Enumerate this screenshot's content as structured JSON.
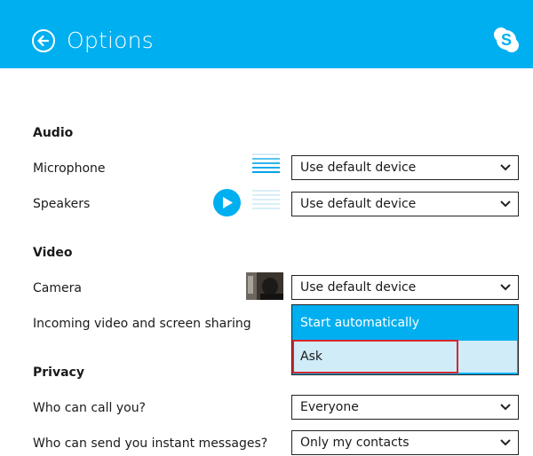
{
  "header": {
    "title": "Options"
  },
  "audio": {
    "section_title": "Audio",
    "microphone_label": "Microphone",
    "microphone_value": "Use default device",
    "speakers_label": "Speakers",
    "speakers_value": "Use default device"
  },
  "video": {
    "section_title": "Video",
    "camera_label": "Camera",
    "camera_value": "Use default device",
    "incoming_label": "Incoming video and screen sharing",
    "incoming_options": [
      "Start automatically",
      "Ask"
    ],
    "incoming_selected": "Ask"
  },
  "privacy": {
    "section_title": "Privacy",
    "call_label": "Who can call you?",
    "call_value": "Everyone",
    "im_label": "Who can send you instant messages?",
    "im_value": "Only my contacts"
  },
  "colors": {
    "accent": "#00aff0",
    "highlight_border": "#d8262e",
    "selected_option_bg": "#d0ecf9"
  },
  "icons": {
    "back": "back-arrow-circle-icon",
    "logo": "skype-logo-icon",
    "play": "play-icon",
    "chevron": "chevron-down-icon"
  }
}
